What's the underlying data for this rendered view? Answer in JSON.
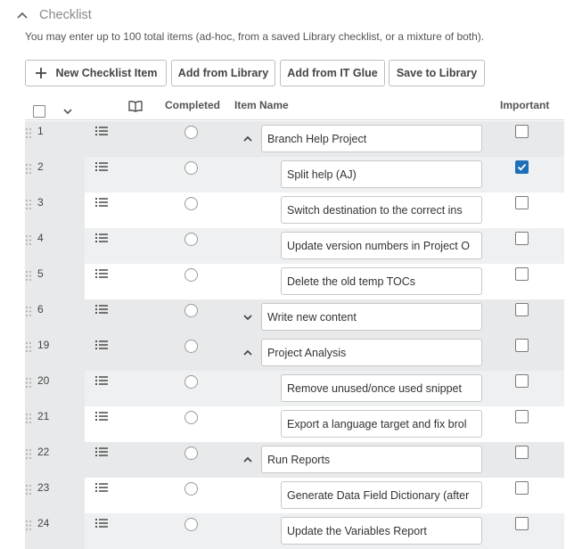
{
  "section": {
    "title": "Checklist",
    "subtitle": "You may enter up to 100 total items (ad-hoc, from a saved Library checklist, or a mixture of both)."
  },
  "toolbar": {
    "new_item": "New Checklist Item",
    "add_library": "Add from Library",
    "add_itglue": "Add from IT Glue",
    "save_library": "Save to Library"
  },
  "columns": {
    "completed": "Completed",
    "item_name": "Item Name",
    "important": "Important"
  },
  "rows": [
    {
      "num": "1",
      "name": "Branch Help Project",
      "level": 0,
      "toggle": "up",
      "important": false
    },
    {
      "num": "2",
      "name": "Split help (AJ)",
      "level": 1,
      "important": true
    },
    {
      "num": "3",
      "name": "Switch destination to the correct ins",
      "level": 1,
      "important": false
    },
    {
      "num": "4",
      "name": "Update version numbers in Project O",
      "level": 1,
      "important": false
    },
    {
      "num": "5",
      "name": "Delete the old temp TOCs",
      "level": 1,
      "important": false
    },
    {
      "num": "6",
      "name": "Write new content",
      "level": 0,
      "toggle": "down",
      "important": false
    },
    {
      "num": "19",
      "name": "Project Analysis",
      "level": 0,
      "toggle": "up",
      "important": false
    },
    {
      "num": "20",
      "name": "Remove unused/once used snippet",
      "level": 1,
      "important": false
    },
    {
      "num": "21",
      "name": "Export a language target and fix brol",
      "level": 1,
      "important": false
    },
    {
      "num": "22",
      "name": "Run Reports",
      "level": 0,
      "toggle": "up",
      "important": false
    },
    {
      "num": "23",
      "name": "Generate Data Field Dictionary (after",
      "level": 1,
      "important": false
    },
    {
      "num": "24",
      "name": "Update the Variables Report",
      "level": 1,
      "important": false
    }
  ],
  "colors": {
    "accent": "#1d6fb8",
    "parent_row_bg": "#e8e9ea",
    "alt_row_bg": "#eef0f1"
  }
}
